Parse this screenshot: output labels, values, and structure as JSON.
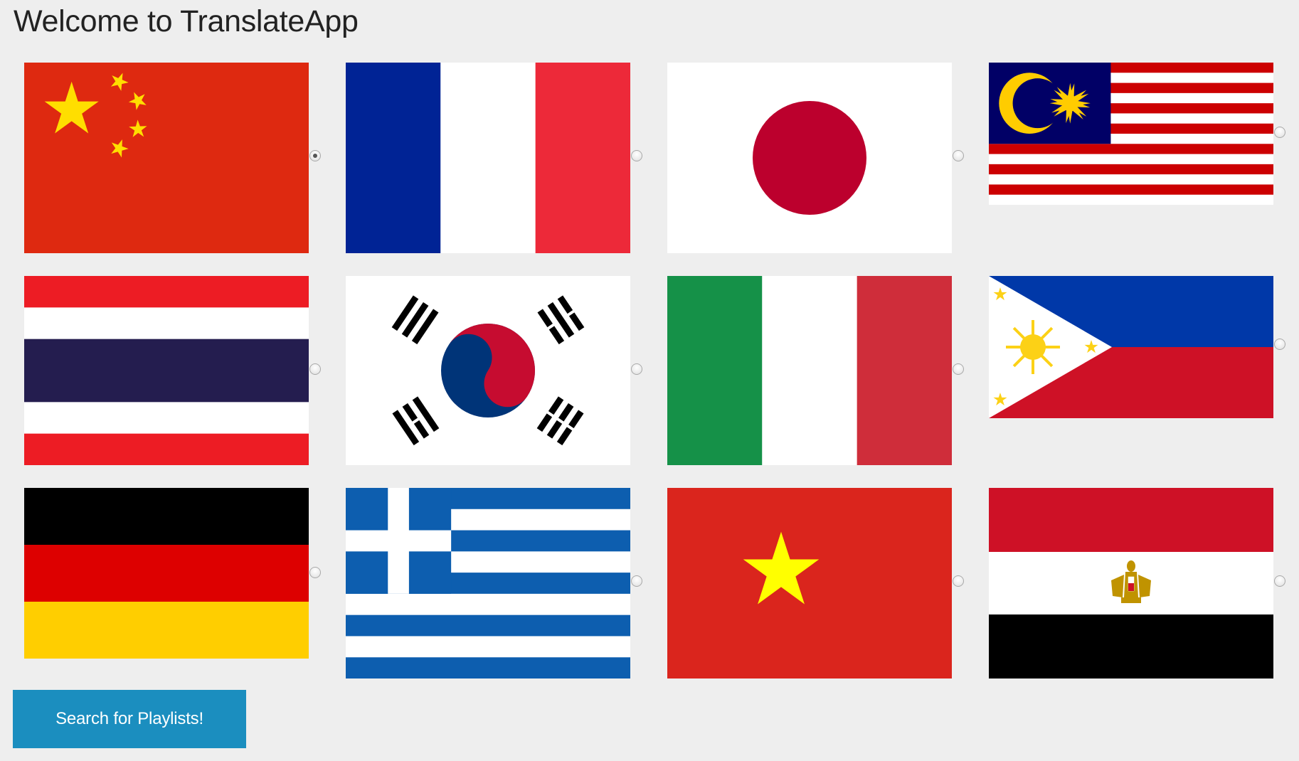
{
  "page": {
    "title": "Welcome to TranslateApp"
  },
  "flags": [
    {
      "country": "china",
      "selected": true
    },
    {
      "country": "france",
      "selected": false
    },
    {
      "country": "japan",
      "selected": false
    },
    {
      "country": "malaysia",
      "selected": false
    },
    {
      "country": "thailand",
      "selected": false
    },
    {
      "country": "south-korea",
      "selected": false
    },
    {
      "country": "italy",
      "selected": false
    },
    {
      "country": "philippines",
      "selected": false
    },
    {
      "country": "germany",
      "selected": false
    },
    {
      "country": "greece",
      "selected": false
    },
    {
      "country": "vietnam",
      "selected": false
    },
    {
      "country": "egypt",
      "selected": false
    }
  ],
  "actions": {
    "search_label": "Search for Playlists!"
  },
  "colors": {
    "background": "#eeeeee",
    "button": "#1b8ebf",
    "button_text": "#ffffff"
  }
}
